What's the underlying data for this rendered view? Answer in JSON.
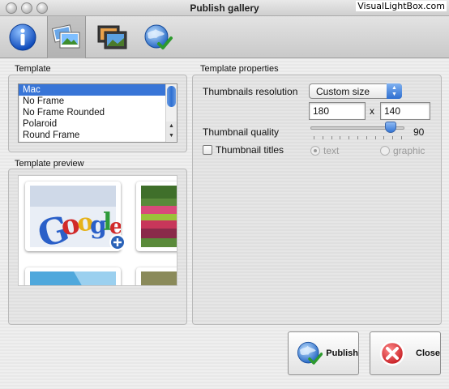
{
  "window": {
    "title": "Publish gallery",
    "watermark": "VisualLightBox.com"
  },
  "toolbar": {
    "items": [
      {
        "name": "info",
        "icon": "info-icon"
      },
      {
        "name": "gallery",
        "icon": "photos-icon",
        "active": true
      },
      {
        "name": "slideshow",
        "icon": "slides-icon"
      },
      {
        "name": "publish",
        "icon": "globe-check-icon"
      }
    ]
  },
  "template": {
    "group_label": "Template",
    "items": [
      "Mac",
      "No Frame",
      "No Frame Rounded",
      "Polaroid",
      "Round Frame"
    ],
    "selected": "Mac"
  },
  "preview": {
    "group_label": "Template preview"
  },
  "properties": {
    "group_label": "Template properties",
    "resolution_label": "Thumbnails resolution",
    "resolution_option": "Custom size",
    "width": "180",
    "height": "140",
    "times": "x",
    "quality_label": "Thumbnail quality",
    "quality_value": "90",
    "titles_label": "Thumbnail titles",
    "titles_checked": false,
    "radio_text": "text",
    "radio_graphic": "graphic",
    "radio_selected": "text"
  },
  "buttons": {
    "publish": "Publish",
    "close": "Close"
  },
  "colors": {
    "selection": "#3875d7",
    "accent": "#2f6fd0",
    "close_red": "#d8262b"
  }
}
